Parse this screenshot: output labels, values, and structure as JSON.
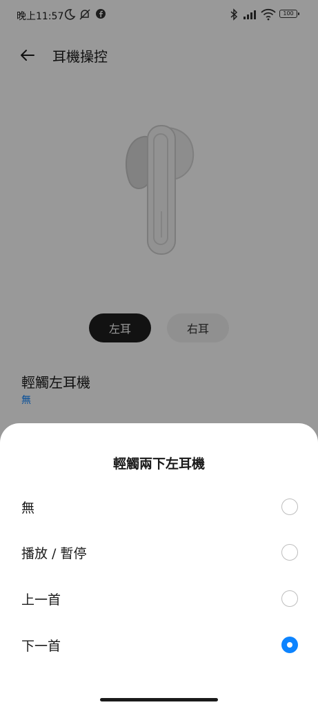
{
  "status_bar": {
    "time": "晚上11:57",
    "battery": "100",
    "icons": [
      "moon-icon",
      "mute-icon",
      "facebook-icon",
      "bluetooth-icon",
      "signal-icon",
      "wifi-icon",
      "battery-icon"
    ]
  },
  "header": {
    "title": "耳機操控",
    "back_icon": "arrow-left-icon"
  },
  "earbud_image": "earbud-illustration",
  "segments": {
    "left": "左耳",
    "right": "右耳",
    "selected": "left"
  },
  "setting": {
    "title": "輕觸左耳機",
    "value": "無"
  },
  "sheet": {
    "title": "輕觸兩下左耳機",
    "options": [
      {
        "label": "無",
        "checked": false
      },
      {
        "label": "播放 / 暫停",
        "checked": false
      },
      {
        "label": "上一首",
        "checked": false
      },
      {
        "label": "下一首",
        "checked": true
      }
    ]
  },
  "colors": {
    "accent": "#0d84ff",
    "overlay": "rgba(0,0,0,0.40)",
    "segment_selected": "#1f1f1f"
  }
}
